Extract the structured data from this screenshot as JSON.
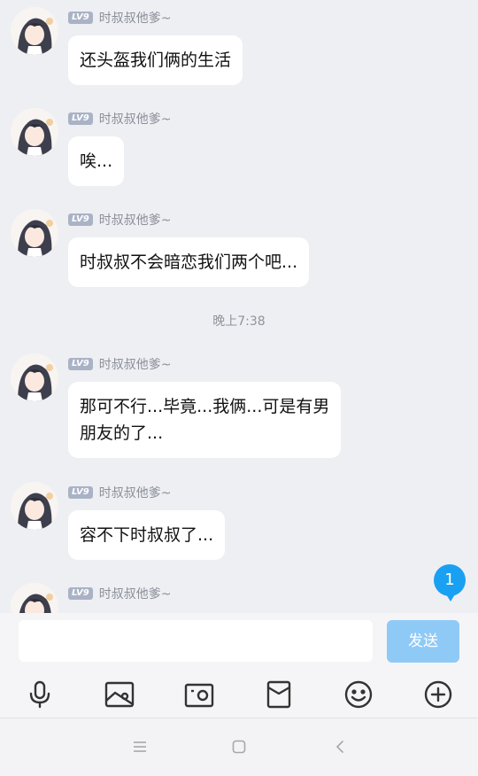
{
  "messages": [
    {
      "level": "LV9",
      "sender": "时叔叔他爹~",
      "text": "还头盔我们俩的生活"
    },
    {
      "level": "LV9",
      "sender": "时叔叔他爹~",
      "text": "唉..."
    },
    {
      "level": "LV9",
      "sender": "时叔叔他爹~",
      "text": "时叔叔不会暗恋我们两个吧..."
    },
    {
      "level": "LV9",
      "sender": "时叔叔他爹~",
      "text": "那可不行...毕竟...我俩...可是有男\n朋友的了..."
    },
    {
      "level": "LV9",
      "sender": "时叔叔他爹~",
      "text": "容不下时叔叔了..."
    },
    {
      "level": "LV9",
      "sender": "时叔叔他爹~",
      "text": ""
    }
  ],
  "timestamp": "晚上7:38",
  "unread_count": "1",
  "input": {
    "value": "",
    "placeholder": ""
  },
  "send_label": "发送",
  "toolbar_icons": [
    "microphone-icon",
    "image-icon",
    "camera-icon",
    "red-envelope-icon",
    "emoji-icon",
    "plus-icon"
  ],
  "nav_icons": [
    "menu-icon",
    "home-square-icon",
    "back-icon"
  ],
  "colors": {
    "accent": "#1aa0f2",
    "send_disabled": "#8fcaf7",
    "background": "#eeeff3",
    "level_badge": "#aab2c6"
  }
}
